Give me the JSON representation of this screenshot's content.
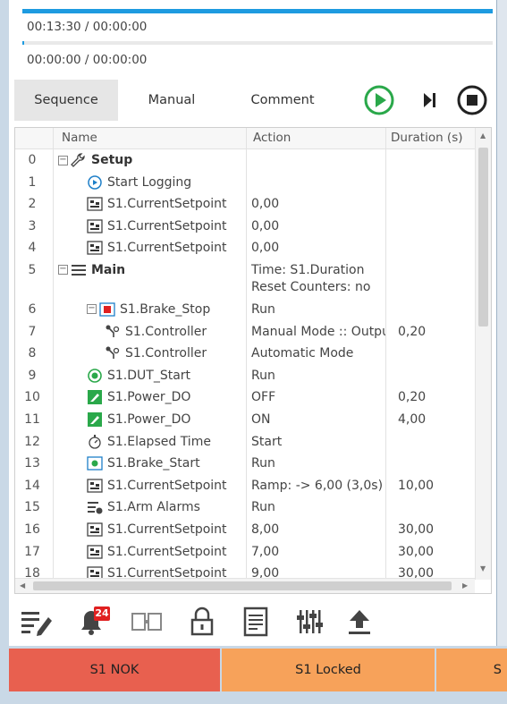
{
  "progress": {
    "main_time": "00:13:30 / 00:00:00",
    "main_fill_percent": 100,
    "step_time": "00:00:00 / 00:00:00",
    "step_fill_percent": 0
  },
  "tabs": [
    {
      "label": "Sequence",
      "active": true
    },
    {
      "label": "Manual",
      "active": false
    },
    {
      "label": "Comment",
      "active": false
    }
  ],
  "controls": {
    "play_icon": "play-circle-icon",
    "step_icon": "step-forward-icon",
    "stop_icon": "stop-circle-icon",
    "play_color": "#2aa84a"
  },
  "table": {
    "headers": {
      "name": "Name",
      "action": "Action",
      "duration": "Duration (s)"
    },
    "rows": [
      {
        "num": "0",
        "name": "Setup",
        "action": "",
        "action2": "",
        "duration": "",
        "icon": "wrench-icon",
        "level": 0,
        "bold": true,
        "expand": "⊟"
      },
      {
        "num": "1",
        "name": "Start Logging",
        "action": "",
        "action2": "",
        "duration": "",
        "icon": "record-start-icon",
        "level": 1,
        "bold": false,
        "expand": ""
      },
      {
        "num": "2",
        "name": "S1.CurrentSetpoint",
        "action": "0,00",
        "action2": "",
        "duration": "",
        "icon": "setpoint-icon",
        "level": 1,
        "bold": false,
        "expand": ""
      },
      {
        "num": "3",
        "name": "S1.CurrentSetpoint",
        "action": "0,00",
        "action2": "",
        "duration": "",
        "icon": "setpoint-icon",
        "level": 1,
        "bold": false,
        "expand": ""
      },
      {
        "num": "4",
        "name": "S1.CurrentSetpoint",
        "action": "0,00",
        "action2": "",
        "duration": "",
        "icon": "setpoint-icon",
        "level": 1,
        "bold": false,
        "expand": ""
      },
      {
        "num": "5",
        "name": "Main",
        "action": "Time: S1.Duration",
        "action2": "Reset Counters: no",
        "duration": "",
        "icon": "list-icon",
        "level": 0,
        "bold": true,
        "expand": "⊟"
      },
      {
        "num": "6",
        "name": "S1.Brake_Stop",
        "action": "Run",
        "action2": "",
        "duration": "",
        "icon": "brake-stop-icon",
        "level": 1,
        "bold": false,
        "expand": "⊟"
      },
      {
        "num": "7",
        "name": "S1.Controller",
        "action": "Manual Mode :: Output",
        "action2": "",
        "duration": "0,20",
        "icon": "controller-icon",
        "level": 2,
        "bold": false,
        "expand": ""
      },
      {
        "num": "8",
        "name": "S1.Controller",
        "action": "Automatic Mode",
        "action2": "",
        "duration": "",
        "icon": "controller-icon",
        "level": 2,
        "bold": false,
        "expand": ""
      },
      {
        "num": "9",
        "name": "S1.DUT_Start",
        "action": "Run",
        "action2": "",
        "duration": "",
        "icon": "dut-start-icon",
        "level": 1,
        "bold": false,
        "expand": ""
      },
      {
        "num": "10",
        "name": "S1.Power_DO",
        "action": "OFF",
        "action2": "",
        "duration": "0,20",
        "icon": "pencil-square-icon",
        "level": 1,
        "bold": false,
        "expand": ""
      },
      {
        "num": "11",
        "name": "S1.Power_DO",
        "action": "ON",
        "action2": "",
        "duration": "4,00",
        "icon": "pencil-square-icon",
        "level": 1,
        "bold": false,
        "expand": ""
      },
      {
        "num": "12",
        "name": "S1.Elapsed Time",
        "action": "Start",
        "action2": "",
        "duration": "",
        "icon": "stopwatch-icon",
        "level": 1,
        "bold": false,
        "expand": ""
      },
      {
        "num": "13",
        "name": "S1.Brake_Start",
        "action": "Run",
        "action2": "",
        "duration": "",
        "icon": "brake-start-icon",
        "level": 1,
        "bold": false,
        "expand": ""
      },
      {
        "num": "14",
        "name": "S1.CurrentSetpoint",
        "action": "Ramp:  -> 6,00 (3,0s)",
        "action2": "",
        "duration": "10,00",
        "icon": "setpoint-icon",
        "level": 1,
        "bold": false,
        "expand": ""
      },
      {
        "num": "15",
        "name": "S1.Arm Alarms",
        "action": "Run",
        "action2": "",
        "duration": "",
        "icon": "alarm-list-icon",
        "level": 1,
        "bold": false,
        "expand": ""
      },
      {
        "num": "16",
        "name": "S1.CurrentSetpoint",
        "action": "8,00",
        "action2": "",
        "duration": "30,00",
        "icon": "setpoint-icon",
        "level": 1,
        "bold": false,
        "expand": ""
      },
      {
        "num": "17",
        "name": "S1.CurrentSetpoint",
        "action": "7,00",
        "action2": "",
        "duration": "30,00",
        "icon": "setpoint-icon",
        "level": 1,
        "bold": false,
        "expand": ""
      },
      {
        "num": "18",
        "name": "S1.CurrentSetpoint",
        "action": "9,00",
        "action2": "",
        "duration": "30,00",
        "icon": "setpoint-icon",
        "level": 1,
        "bold": false,
        "expand": ""
      }
    ]
  },
  "bottom_toolbar": {
    "alarm_count": "24",
    "buttons": [
      "edit-icon",
      "bell-icon",
      "compare-icon",
      "lock-icon",
      "document-icon",
      "sliders-icon",
      "upload-icon"
    ]
  },
  "status_bar": [
    {
      "label": "S1 NOK",
      "color": "#e8604f"
    },
    {
      "label": "S1 Locked",
      "color": "#f7a25a"
    },
    {
      "label": "S",
      "color": "#f7a25a"
    }
  ]
}
